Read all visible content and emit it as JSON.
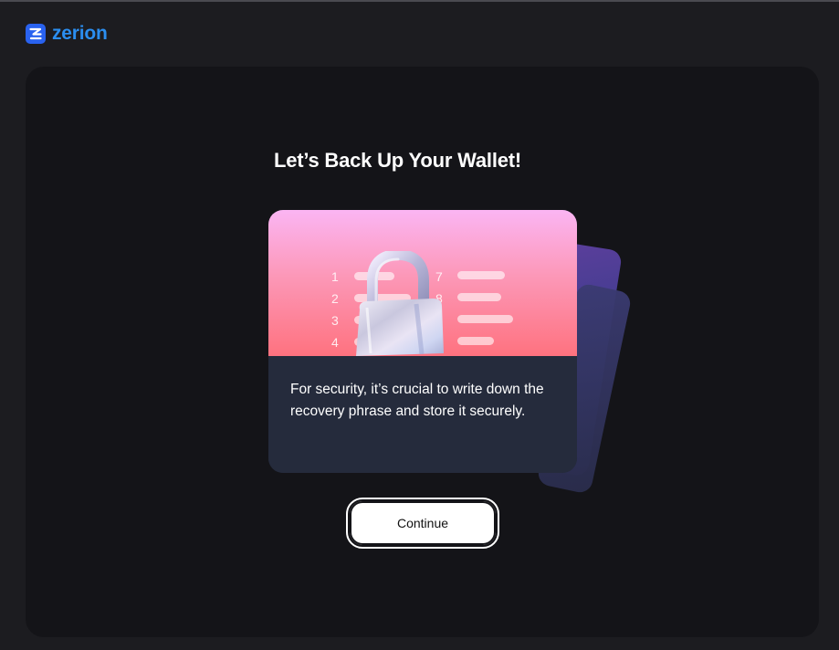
{
  "brand": {
    "name": "zerion",
    "accent": "#2962ef"
  },
  "main": {
    "title": "Let’s Back Up Your Wallet!",
    "description": "For security, it’s crucial to write down the recovery phrase and store it securely.",
    "illustration": {
      "numbers": [
        "1",
        "2",
        "3",
        "4",
        "7",
        "8"
      ],
      "icon": "padlock-icon"
    },
    "continue_label": "Continue"
  }
}
